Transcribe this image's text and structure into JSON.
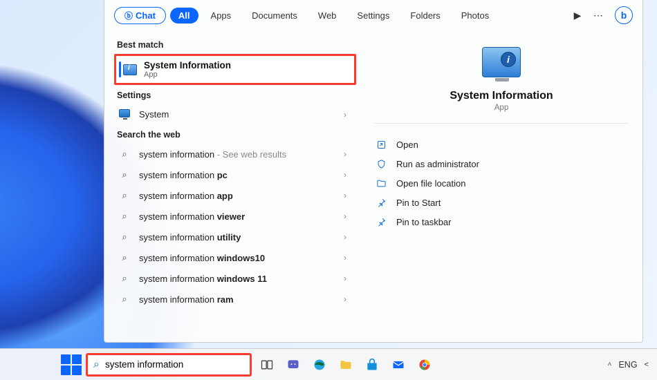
{
  "tabs": {
    "chat": "Chat",
    "items": [
      {
        "label": "All",
        "active": true
      },
      {
        "label": "Apps",
        "active": false
      },
      {
        "label": "Documents",
        "active": false
      },
      {
        "label": "Web",
        "active": false
      },
      {
        "label": "Settings",
        "active": false
      },
      {
        "label": "Folders",
        "active": false
      },
      {
        "label": "Photos",
        "active": false
      }
    ]
  },
  "sections": {
    "best_match": "Best match",
    "settings": "Settings",
    "search_web": "Search the web"
  },
  "best": {
    "title": "System Information",
    "subtitle": "App"
  },
  "settings_items": [
    {
      "label": "System"
    }
  ],
  "web_items": [
    {
      "prefix": "system information",
      "bold": "",
      "suffix": " - See web results"
    },
    {
      "prefix": "system information ",
      "bold": "pc",
      "suffix": ""
    },
    {
      "prefix": "system information ",
      "bold": "app",
      "suffix": ""
    },
    {
      "prefix": "system information ",
      "bold": "viewer",
      "suffix": ""
    },
    {
      "prefix": "system information ",
      "bold": "utility",
      "suffix": ""
    },
    {
      "prefix": "system information ",
      "bold": "windows10",
      "suffix": ""
    },
    {
      "prefix": "system information ",
      "bold": "windows 11",
      "suffix": ""
    },
    {
      "prefix": "system information ",
      "bold": "ram",
      "suffix": ""
    }
  ],
  "preview": {
    "title": "System Information",
    "subtitle": "App",
    "actions": [
      {
        "icon": "open",
        "label": "Open"
      },
      {
        "icon": "admin",
        "label": "Run as administrator"
      },
      {
        "icon": "folder",
        "label": "Open file location"
      },
      {
        "icon": "pin",
        "label": "Pin to Start"
      },
      {
        "icon": "pin",
        "label": "Pin to taskbar"
      }
    ]
  },
  "taskbar": {
    "search_value": "system information",
    "lang": "ENG"
  }
}
